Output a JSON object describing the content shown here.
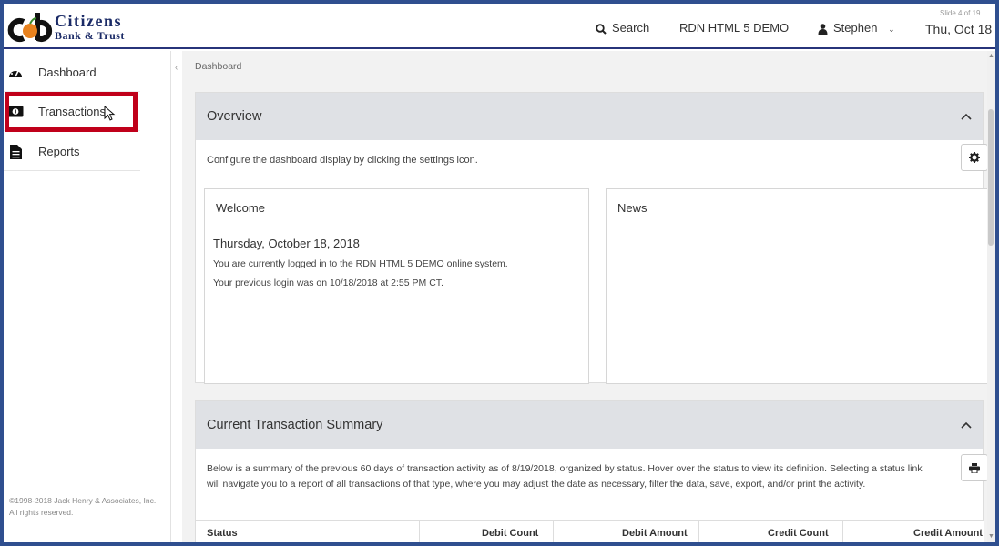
{
  "header": {
    "logo_line1": "Citizens",
    "logo_line2": "Bank & Trust",
    "search_label": "Search",
    "system_name": "RDN HTML 5 DEMO",
    "user_name": "Stephen",
    "date": "Thu, Oct 18",
    "slide_indicator": "Slide 4 of 19"
  },
  "sidebar": {
    "items": [
      {
        "label": "Dashboard",
        "icon": "dashboard-gauge-icon"
      },
      {
        "label": "Transactions",
        "icon": "money-icon"
      },
      {
        "label": "Reports",
        "icon": "document-icon"
      }
    ],
    "copyright": "©1998-2018 Jack Henry & Associates, Inc. All rights reserved."
  },
  "content": {
    "breadcrumb": "Dashboard",
    "overview": {
      "title": "Overview",
      "description": "Configure the dashboard display by clicking the settings icon.",
      "welcome": {
        "title": "Welcome",
        "date": "Thursday, October 18, 2018",
        "line1": "You are currently logged in to the RDN HTML 5 DEMO online system.",
        "line2": "Your previous login was on 10/18/2018 at 2:55 PM CT."
      },
      "news": {
        "title": "News"
      }
    },
    "summary": {
      "title": "Current Transaction Summary",
      "description": "Below is a summary of the previous 60 days of transaction activity as of 8/19/2018, organized by status. Hover over the status to view its definition. Selecting a status link will navigate you to a report of all transactions of that type, where you may adjust the date as necessary, filter the data, save, export, and/or print the activity.",
      "columns": [
        "Status",
        "Debit Count",
        "Debit Amount",
        "Credit Count",
        "Credit Amount"
      ]
    }
  },
  "colors": {
    "brand_navy": "#27347a",
    "highlight_red": "#c0001a",
    "panel_header": "#dfe1e5",
    "logo_orange": "#e8821e"
  }
}
